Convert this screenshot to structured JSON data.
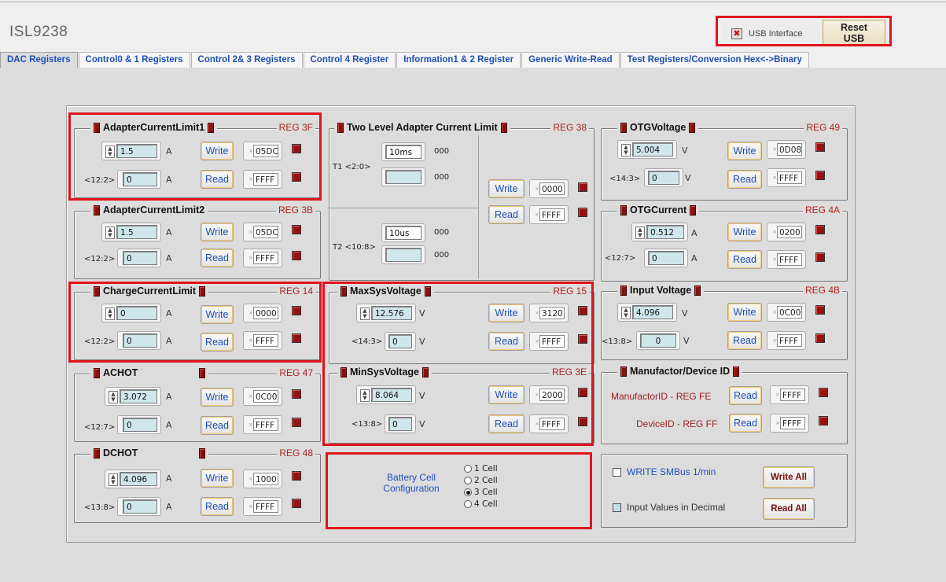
{
  "app_title": "ISL9238",
  "usb": {
    "interface_label": "USB Interface",
    "reset_label_1": "Reset",
    "reset_label_2": "USB",
    "status_icon": "red-x-icon"
  },
  "tabs": [
    "DAC Registers",
    "Control0 & 1 Registers",
    "Control 2& 3 Registers",
    "Control 4 Register",
    "Information1 & 2 Register",
    "Generic Write-Read",
    "Test Registers/Conversion Hex<->Binary"
  ],
  "common": {
    "write": "Write",
    "read": "Read",
    "unit_a": "A",
    "unit_v": "V",
    "ffff": "FFFF"
  },
  "groups": {
    "acl1": {
      "title": "AdapterCurrentLimit1",
      "reg": "REG 3F",
      "value": "1.5",
      "bits": "<12:2>",
      "read_value": "0",
      "write_hex": "05DC"
    },
    "acl2": {
      "title": "AdapterCurrentLimit2",
      "reg": "REG 3B",
      "value": "1.5",
      "bits": "<12:2>",
      "read_value": "0",
      "write_hex": "05DC"
    },
    "ccl": {
      "title": "ChargeCurrentLimit",
      "reg": "REG 14",
      "value": "0",
      "bits": "<12:2>",
      "read_value": "0",
      "write_hex": "0000"
    },
    "achot": {
      "title": "ACHOT",
      "reg": "REG 47",
      "value": "3.072",
      "bits": "<12:7>",
      "read_value": "0",
      "write_hex": "0C00"
    },
    "dchot": {
      "title": "DCHOT",
      "reg": "REG 48",
      "value": "4.096",
      "bits": "<13:8>",
      "read_value": "0",
      "write_hex": "1000"
    },
    "twolevel": {
      "title": "Two Level Adapter Current Limit",
      "reg": "REG 38",
      "t1_label": "T1 <2:0>",
      "t1_value": "10ms",
      "t1_code": "000",
      "t1_read_code": "000",
      "t2_label": "T2 <10:8>",
      "t2_value": "10us",
      "t2_code": "000",
      "t2_read_code": "000",
      "write_hex": "0000"
    },
    "maxsys": {
      "title": "MaxSysVoltage",
      "reg": "REG 15",
      "value": "12.576",
      "bits": "<14:3>",
      "read_value": "0",
      "write_hex": "3120"
    },
    "minsys": {
      "title": "MinSysVoltage",
      "reg": "REG 3E",
      "value": "8.064",
      "bits": "<13:8>",
      "read_value": "0",
      "write_hex": "2000"
    },
    "otgv": {
      "title": "OTGVoltage",
      "reg": "REG 49",
      "value": "5.004",
      "bits": "<14:3>",
      "read_value": "0",
      "write_hex": "0D08"
    },
    "otgc": {
      "title": "OTGCurrent",
      "reg": "REG 4A",
      "value": "0.512",
      "bits": "<12:7>",
      "read_value": "0",
      "write_hex": "0200"
    },
    "inv": {
      "title": "Input Voltage",
      "reg": "REG 4B",
      "value": "4.096",
      "bits": "<13:8>",
      "read_value": "0",
      "write_hex": "0C00"
    },
    "mfg": {
      "title": "Manufactor/Device ID",
      "mfg_label": "ManufactorID - REG FE",
      "dev_label": "DeviceID - REG FF"
    }
  },
  "battery": {
    "label_1": "Battery Cell",
    "label_2": "Configuration",
    "options": [
      "1 Cell",
      "2 Cell",
      "3 Cell",
      "4 Cell"
    ],
    "selected": "3 Cell"
  },
  "misc": {
    "write_smbus": "WRITE SMBus 1/min",
    "input_decimal": "Input Values in Decimal",
    "write_all": "Write All",
    "read_all": "Read All"
  }
}
